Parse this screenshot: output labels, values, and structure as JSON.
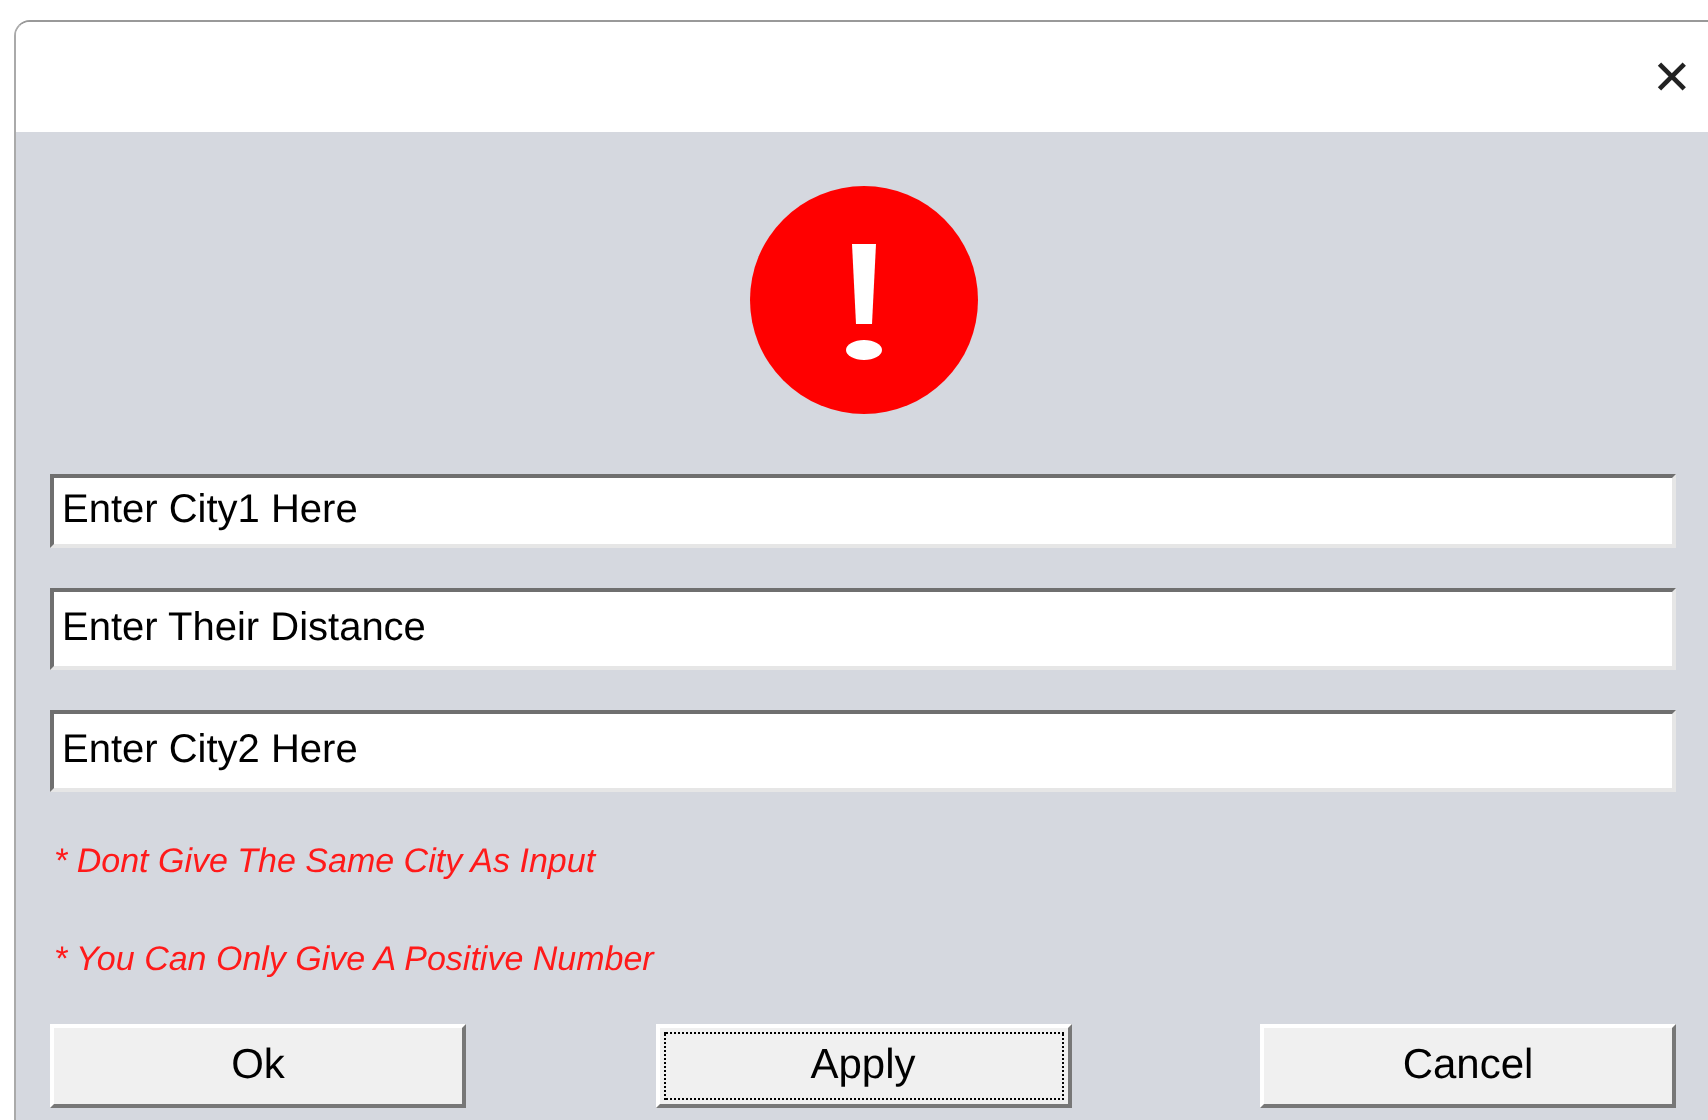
{
  "window": {
    "close_label": "✕"
  },
  "fields": [
    {
      "value": "Enter City1 Here"
    },
    {
      "value": "Enter Their Distance"
    },
    {
      "value": "Enter City2 Here"
    }
  ],
  "notes": [
    "* Dont Give The Same City As Input",
    "* You Can Only Give A Positive Number"
  ],
  "buttons": [
    {
      "label": "Ok",
      "focused": false
    },
    {
      "label": "Apply",
      "focused": true
    },
    {
      "label": "Cancel",
      "focused": false
    }
  ]
}
